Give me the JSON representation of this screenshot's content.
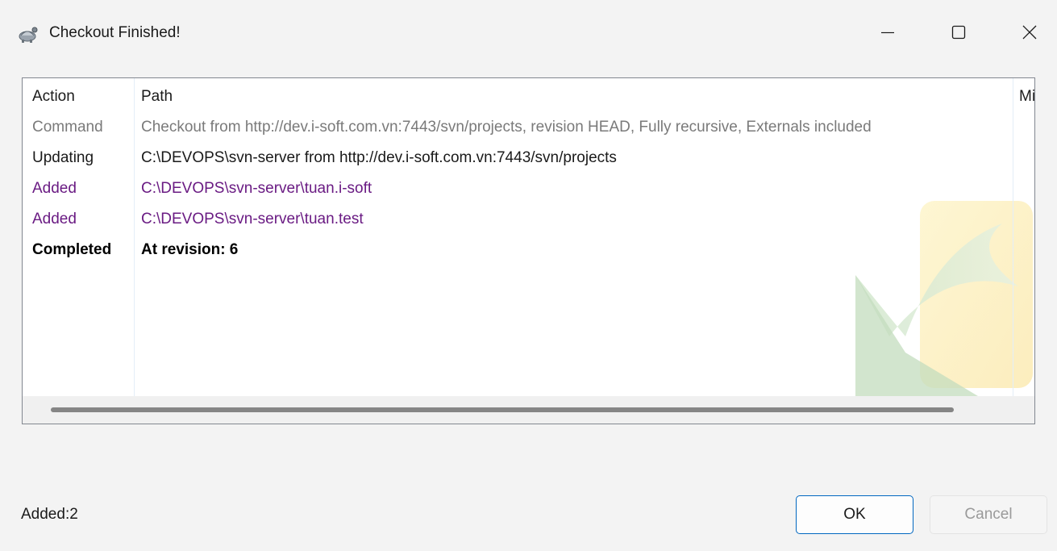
{
  "window": {
    "title": "Checkout Finished!",
    "icons": {
      "app": "tortoise-icon",
      "minimize": "minimize-icon",
      "maximize": "maximize-icon",
      "close": "close-icon"
    }
  },
  "list": {
    "columns": [
      "Action",
      "Path",
      "Mir"
    ],
    "rows": [
      {
        "action": "Command",
        "path": "Checkout from http://dev.i-soft.com.vn:7443/svn/projects, revision HEAD, Fully recursive, Externals included",
        "style": "command"
      },
      {
        "action": "Updating",
        "path": "C:\\DEVOPS\\svn-server from http://dev.i-soft.com.vn:7443/svn/projects",
        "style": "normal"
      },
      {
        "action": "Added",
        "path": "C:\\DEVOPS\\svn-server\\tuan.i-soft",
        "style": "added"
      },
      {
        "action": "Added",
        "path": "C:\\DEVOPS\\svn-server\\tuan.test",
        "style": "added"
      },
      {
        "action": "Completed",
        "path": "At revision: 6",
        "style": "bold"
      }
    ],
    "colors": {
      "command": "#7a7a7a",
      "normal": "#1a1a1a",
      "added": "#6a1b83",
      "bold": "#000000"
    }
  },
  "status": {
    "text": "Added:2"
  },
  "buttons": {
    "ok": "OK",
    "cancel": "Cancel"
  }
}
